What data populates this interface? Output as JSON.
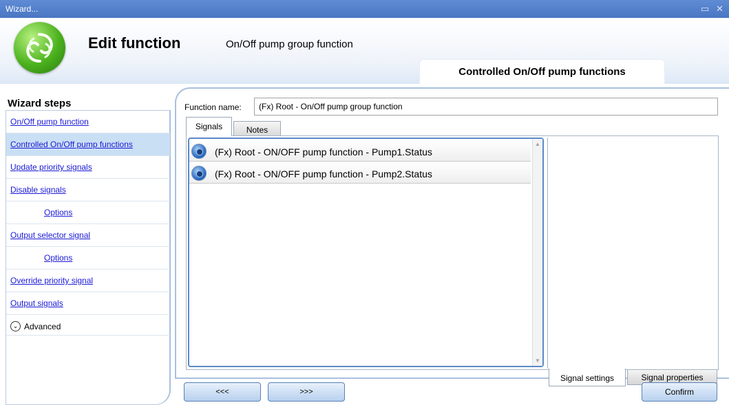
{
  "window": {
    "title": "Wizard...",
    "restore_glyph": "▭",
    "close_glyph": "✕"
  },
  "header": {
    "title": "Edit function",
    "subtitle": "On/Off pump group function",
    "current_step_tab": "Controlled On/Off pump functions"
  },
  "sidebar": {
    "heading": "Wizard steps",
    "items": [
      {
        "label": "On/Off pump function",
        "active": false
      },
      {
        "label": "Controlled On/Off pump functions",
        "active": true
      },
      {
        "label": "Update priority signals",
        "active": false
      },
      {
        "label": "Disable signals",
        "active": false
      },
      {
        "label": "Options",
        "active": false,
        "sub": true
      },
      {
        "label": "Output selector signal",
        "active": false
      },
      {
        "label": "Options",
        "active": false,
        "sub": true
      },
      {
        "label": "Override priority signal",
        "active": false
      },
      {
        "label": "Output signals",
        "active": false
      }
    ],
    "advanced_label": "Advanced",
    "advanced_glyph": "⌄"
  },
  "form": {
    "function_name_label": "Function name:",
    "function_name_value": "(Fx) Root - On/Off pump group function"
  },
  "tabs": {
    "signals": "Signals",
    "notes": "Notes"
  },
  "signals": [
    "(Fx) Root - ON/OFF pump function - Pump1.Status",
    "(Fx) Root - ON/OFF pump function - Pump2.Status"
  ],
  "bottom_tabs": {
    "signal_settings": "Signal settings",
    "signal_properties": "Signal properties"
  },
  "buttons": {
    "prev": "<<<",
    "next": ">>>",
    "confirm": "Confirm"
  },
  "colors": {
    "titlebar": "#4a76c3",
    "link": "#1a1ad6",
    "active_item": "#c9dff4",
    "logo": "#4bb21d"
  }
}
